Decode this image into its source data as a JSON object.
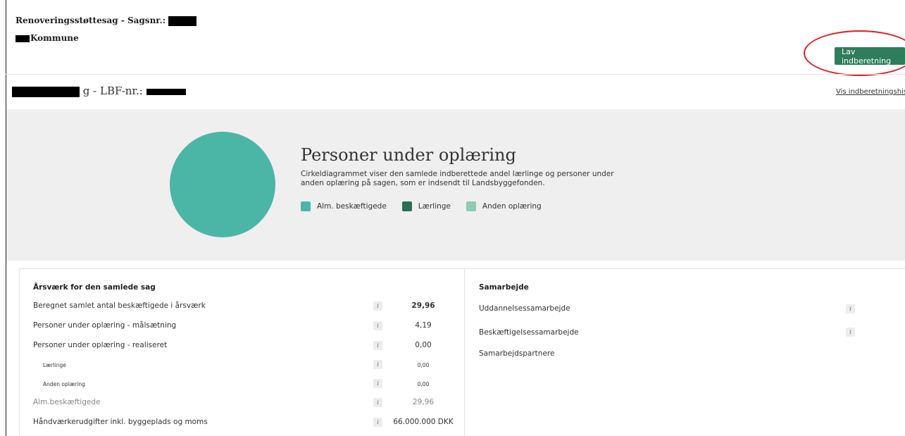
{
  "header": {
    "case_title": "Renoveringsstøttesag - Sagsnr.:",
    "municipality": "Kommune",
    "report_button": "Lav indberetning"
  },
  "subheader": {
    "title_suffix": "g - LBF-nr.:",
    "history_link": "Vis indberetningshistor"
  },
  "chart": {
    "title": "Personer under oplæring",
    "description": "Cirkeldiagrammet viser den samlede indberettede andel lærlinge og personer under anden oplæring på sagen, som er indsendt til Landsbyggefonden.",
    "legend": [
      {
        "label": "Alm. beskæftigede",
        "color": "#4cb6a6"
      },
      {
        "label": "Lærlinge",
        "color": "#2a6e53"
      },
      {
        "label": "Anden oplæring",
        "color": "#8fcab1"
      }
    ]
  },
  "chart_data": {
    "type": "pie",
    "title": "Personer under oplæring",
    "categories": [
      "Alm. beskæftigede",
      "Lærlinge",
      "Anden oplæring"
    ],
    "values": [
      29.96,
      0.0,
      0.0
    ],
    "colors": [
      "#4cb6a6",
      "#2a6e53",
      "#8fcab1"
    ]
  },
  "left_panel": {
    "heading": "Årsværk for den samlede sag",
    "info_glyph": "i",
    "rows": [
      {
        "label": "Beregnet samlet antal beskæftigede i årsværk",
        "value": "29,96"
      },
      {
        "label": "Personer under oplæring - målsætning",
        "value": "4,19"
      },
      {
        "label": "Personer under oplæring - realiseret",
        "value": "0,00"
      },
      {
        "label": "Lærlinge",
        "value": "0,00"
      },
      {
        "label": "Anden oplæring",
        "value": "0,00"
      },
      {
        "label": "Alm.beskæftigede",
        "value": "29,96"
      },
      {
        "label": "Håndværkerudgifter inkl. byggeplads og moms",
        "value": "66.000.000 DKK"
      }
    ]
  },
  "right_panel": {
    "heading": "Samarbejde",
    "info_glyph": "i",
    "rows": [
      {
        "label": "Uddannelsessamarbejde"
      },
      {
        "label": "Beskæftigelsessamarbejde"
      },
      {
        "label": "Samarbejdspartnere"
      }
    ]
  },
  "colors": {
    "accent_button": "#2e7d5b",
    "highlight_circle": "#e31e24",
    "band_background": "#efefef"
  }
}
